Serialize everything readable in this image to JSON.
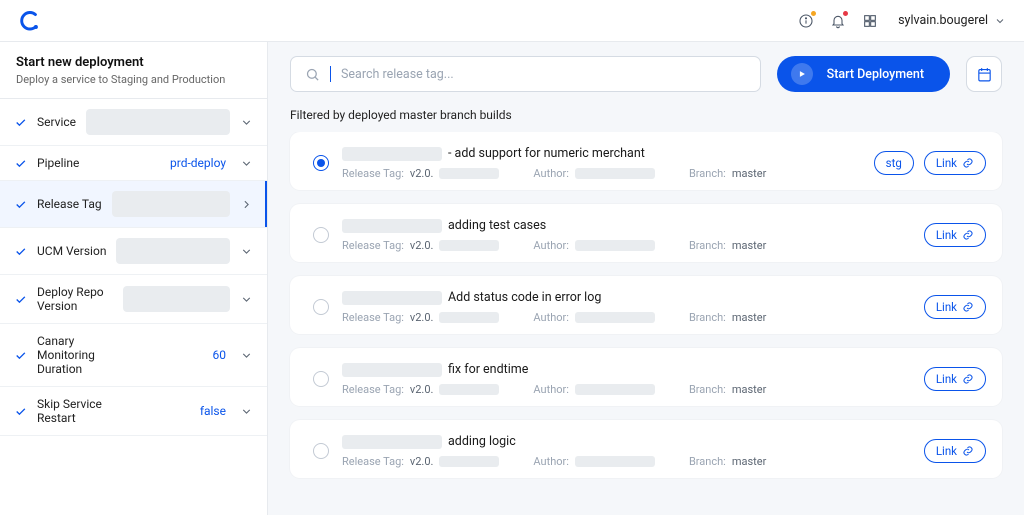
{
  "header": {
    "user_name": "sylvain.bougerel"
  },
  "sidebar": {
    "title": "Start new deployment",
    "subtitle": "Deploy a service to Staging and Production",
    "items": [
      {
        "label": "Service",
        "value": "",
        "hasPill": true
      },
      {
        "label": "Pipeline",
        "value": "prd-deploy",
        "hasPill": false,
        "valueColor": "blue"
      },
      {
        "label": "Release Tag",
        "value": "",
        "hasPill": true,
        "active": true,
        "chevron": "right"
      },
      {
        "label": "UCM Version",
        "value": "",
        "hasPill": true
      },
      {
        "label": "Deploy Repo Version",
        "value": "",
        "hasPill": true
      },
      {
        "label": "Canary Monitoring Duration",
        "value": "60",
        "hasPill": false,
        "valueColor": "blue"
      },
      {
        "label": "Skip Service Restart",
        "value": "false",
        "hasPill": false,
        "valueColor": "blue"
      }
    ]
  },
  "toolbar": {
    "search_placeholder": "Search release tag...",
    "start_label": "Start Deployment"
  },
  "main": {
    "filter_text": "Filtered by deployed master branch builds",
    "release_tag_prefix_label": "Release Tag:",
    "release_tag_prefix": "v2.0.",
    "author_label": "Author:",
    "branch_label": "Branch:",
    "branch_value": "master",
    "stg_label": "stg",
    "link_label": "Link",
    "builds": [
      {
        "title_suffix": "- add support for numeric merchant",
        "selected": true,
        "show_stg": true
      },
      {
        "title_suffix": "adding test cases",
        "selected": false,
        "show_stg": false
      },
      {
        "title_suffix": "Add status code in error log",
        "selected": false,
        "show_stg": false
      },
      {
        "title_suffix": "fix for endtime",
        "selected": false,
        "show_stg": false
      },
      {
        "title_suffix": "adding logic",
        "selected": false,
        "show_stg": false
      }
    ]
  }
}
